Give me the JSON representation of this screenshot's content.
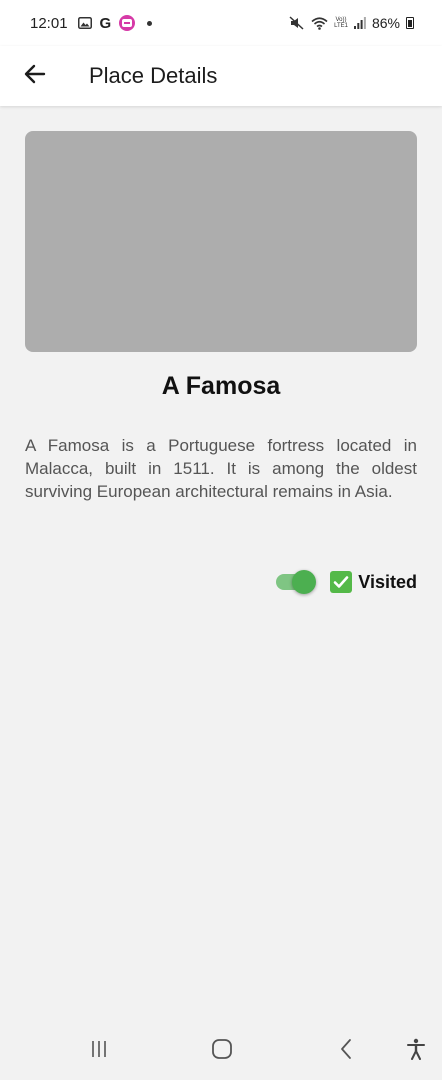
{
  "status_bar": {
    "time": "12:01",
    "google_letter": "G",
    "battery": "86%",
    "volte_top": "Vo))",
    "volte_bottom": "LTE1"
  },
  "app_bar": {
    "title": "Place Details"
  },
  "place": {
    "name": "A Famosa",
    "description": "A Famosa is a Portuguese fortress located in Malacca, built in 1511. It is among the oldest surviving European architectural remains in Asia.",
    "visited_label": "Visited",
    "visited": true
  },
  "colors": {
    "accent": "#4caf50",
    "placeholder": "#adadad",
    "background": "#f2f2f2"
  },
  "icons": {
    "back": "arrow-left-icon",
    "recents": "recents-icon",
    "home": "home-icon",
    "nav_back": "nav-back-icon",
    "accessibility": "accessibility-icon"
  }
}
